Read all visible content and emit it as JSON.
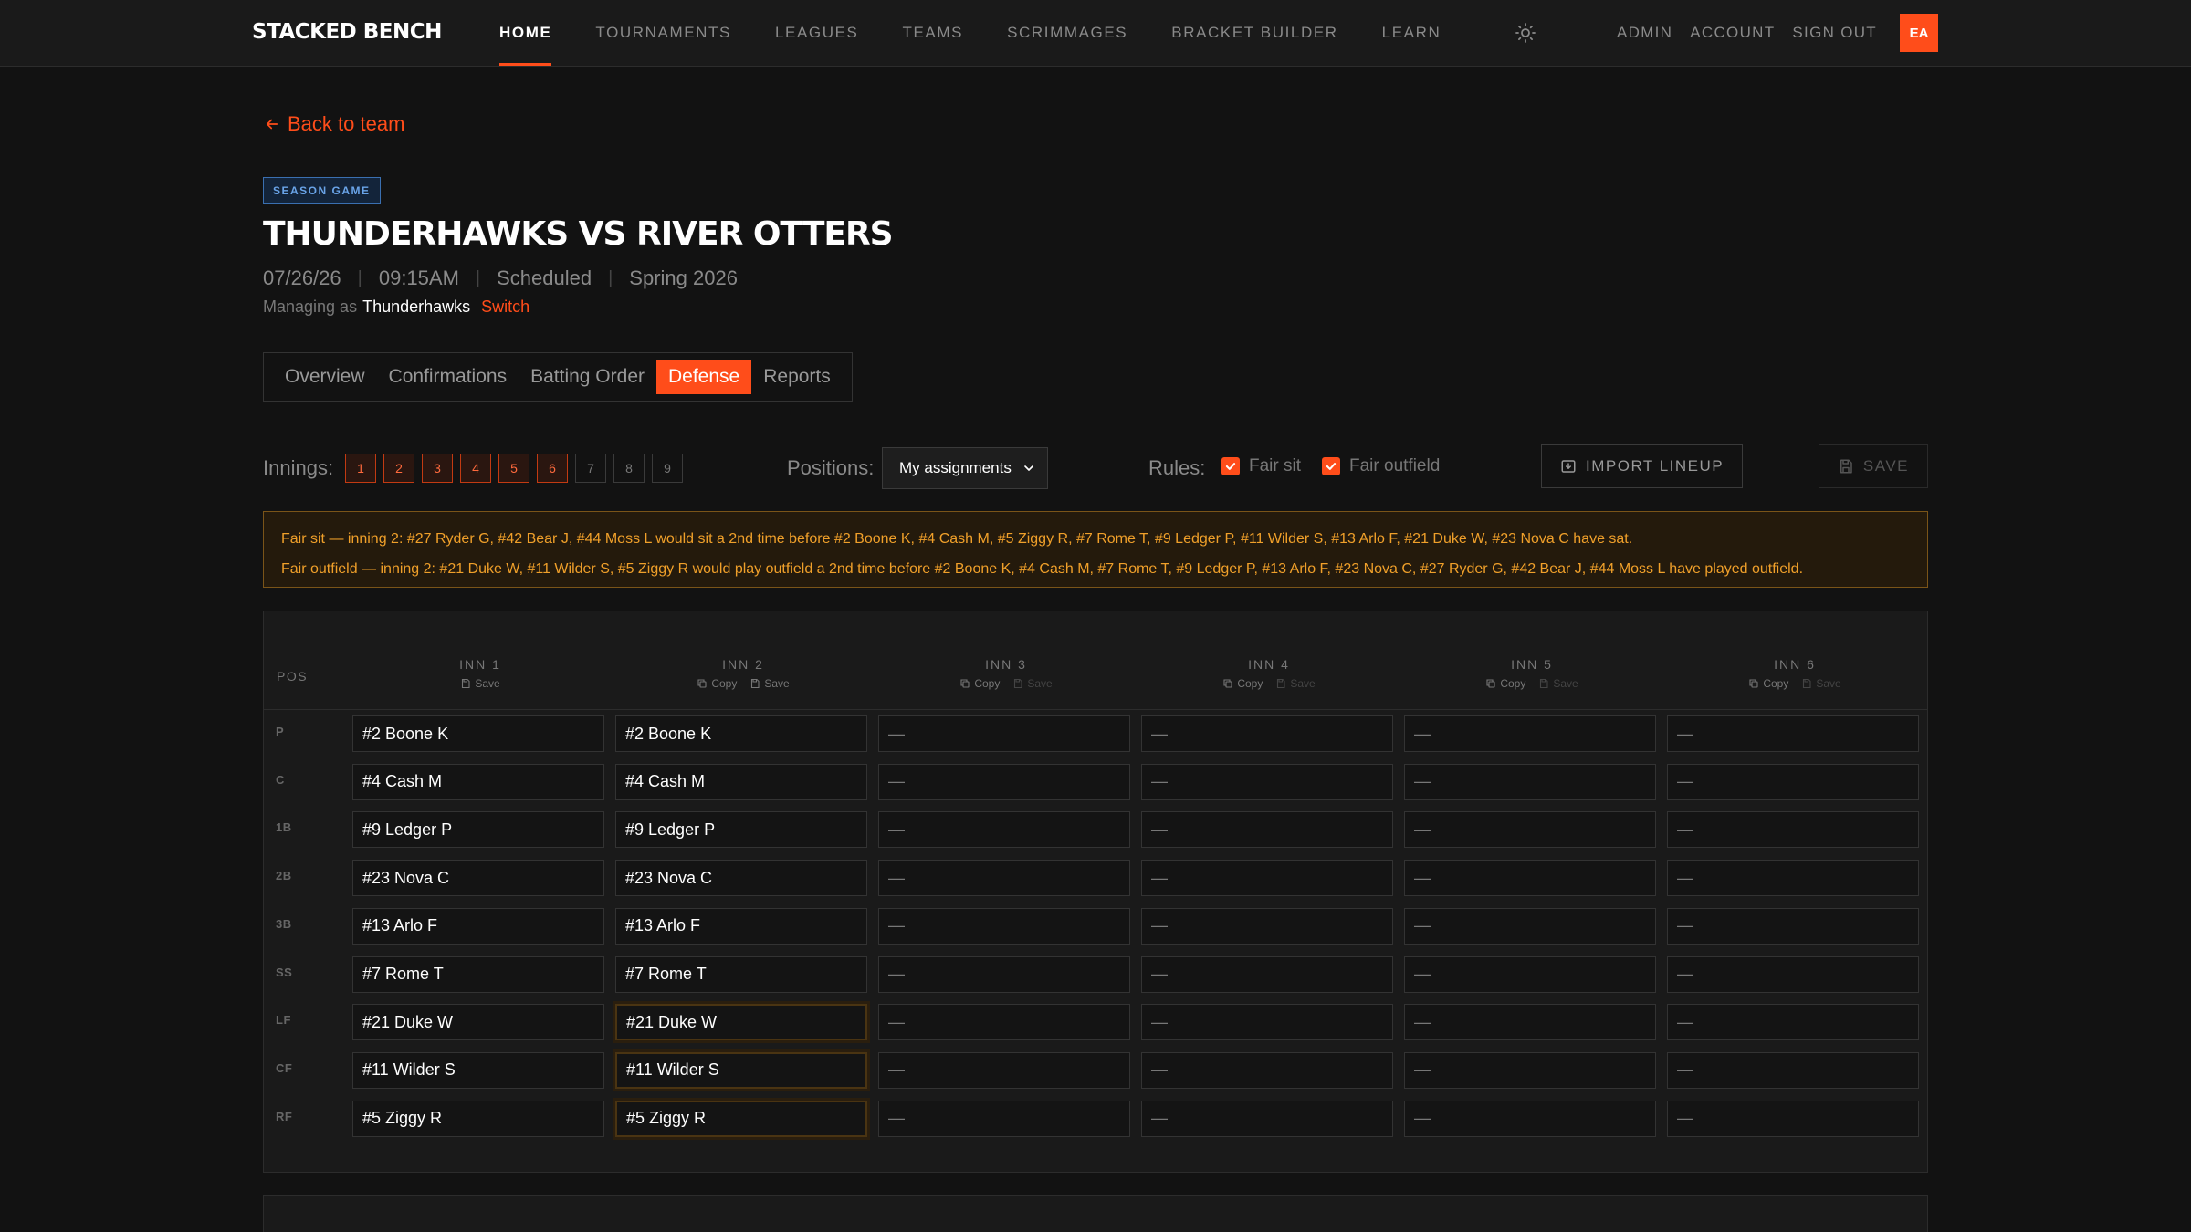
{
  "brand": "STACKED BENCH",
  "nav": {
    "links": [
      "HOME",
      "TOURNAMENTS",
      "LEAGUES",
      "TEAMS",
      "SCRIMMAGES",
      "BRACKET BUILDER",
      "LEARN"
    ],
    "right": [
      "ADMIN",
      "ACCOUNT",
      "SIGN OUT"
    ],
    "avatar": "EA"
  },
  "back_label": "Back to team",
  "badge": "SEASON GAME",
  "title": "THUNDERHAWKS VS RIVER OTTERS",
  "meta": {
    "date": "07/26/26",
    "time": "09:15AM",
    "status": "Scheduled",
    "season": "Spring 2026"
  },
  "managing": {
    "prefix": "Managing as",
    "team": "Thunderhawks",
    "switch": "Switch"
  },
  "tabs": [
    "Overview",
    "Confirmations",
    "Batting Order",
    "Defense",
    "Reports"
  ],
  "active_tab": "Defense",
  "controls": {
    "innings_label": "Innings:",
    "innings": [
      "1",
      "2",
      "3",
      "4",
      "5",
      "6",
      "7",
      "8",
      "9"
    ],
    "innings_selected": 6,
    "positions_label": "Positions:",
    "positions_value": "My assignments",
    "rules_label": "Rules:",
    "rule_fair_sit": "Fair sit",
    "rule_fair_outfield": "Fair outfield",
    "import": "IMPORT LINEUP",
    "save": "SAVE"
  },
  "warnings": [
    "Fair sit — inning 2: #27 Ryder G, #42 Bear J, #44 Moss L would sit a 2nd time before #2 Boone K, #4 Cash M, #5 Ziggy R, #7 Rome T, #9 Ledger P, #11 Wilder S, #13 Arlo F, #21 Duke W, #23 Nova C have sat.",
    "Fair outfield — inning 2: #21 Duke W, #11 Wilder S, #5 Ziggy R would play outfield a 2nd time before #2 Boone K, #4 Cash M, #7 Rome T, #9 Ledger P, #13 Arlo F, #23 Nova C, #27 Ryder G, #42 Bear J, #44 Moss L have played outfield."
  ],
  "grid": {
    "pos_header": "POS",
    "columns": [
      {
        "name": "INN 1",
        "copy": "",
        "save": "Save"
      },
      {
        "name": "INN 2",
        "copy": "Copy",
        "save": "Save"
      },
      {
        "name": "INN 3",
        "copy": "Copy",
        "save": "Save"
      },
      {
        "name": "INN 4",
        "copy": "Copy",
        "save": "Save"
      },
      {
        "name": "INN 5",
        "copy": "Copy",
        "save": "Save"
      },
      {
        "name": "INN 6",
        "copy": "Copy",
        "save": "Save"
      }
    ],
    "rows": [
      {
        "pos": "P",
        "cells": [
          "#2 Boone K",
          "#2 Boone K",
          "—",
          "—",
          "—",
          "—"
        ]
      },
      {
        "pos": "C",
        "cells": [
          "#4 Cash M",
          "#4 Cash M",
          "—",
          "—",
          "—",
          "—"
        ]
      },
      {
        "pos": "1B",
        "cells": [
          "#9 Ledger P",
          "#9 Ledger P",
          "—",
          "—",
          "—",
          "—"
        ]
      },
      {
        "pos": "2B",
        "cells": [
          "#23 Nova C",
          "#23 Nova C",
          "—",
          "—",
          "—",
          "—"
        ]
      },
      {
        "pos": "3B",
        "cells": [
          "#13 Arlo F",
          "#13 Arlo F",
          "—",
          "—",
          "—",
          "—"
        ]
      },
      {
        "pos": "SS",
        "cells": [
          "#7 Rome T",
          "#7 Rome T",
          "—",
          "—",
          "—",
          "—"
        ]
      },
      {
        "pos": "LF",
        "cells": [
          "#21 Duke W",
          "#21 Duke W",
          "—",
          "—",
          "—",
          "—"
        ]
      },
      {
        "pos": "CF",
        "cells": [
          "#11 Wilder S",
          "#11 Wilder S",
          "—",
          "—",
          "—",
          "—"
        ]
      },
      {
        "pos": "RF",
        "cells": [
          "#5 Ziggy R",
          "#5 Ziggy R",
          "—",
          "—",
          "—",
          "—"
        ]
      }
    ],
    "flagged": [
      [
        "LF",
        1
      ],
      [
        "CF",
        1
      ],
      [
        "RF",
        1
      ]
    ]
  },
  "colors": {
    "accent": "#ff4d1a",
    "warning": "#f0a02a",
    "badge": "#6aa4e8"
  }
}
